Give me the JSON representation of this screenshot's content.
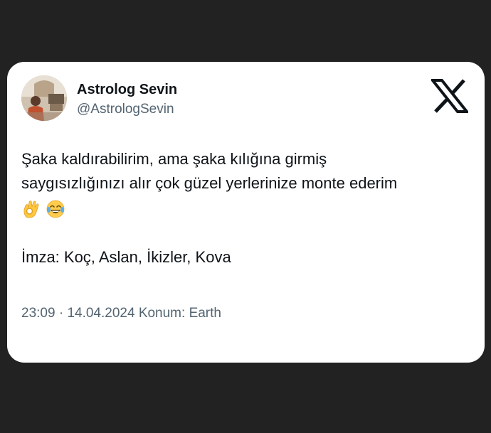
{
  "tweet": {
    "author": {
      "display_name": "Astrolog Sevin",
      "handle": "@AstrologSevin"
    },
    "platform_icon": "x-logo-icon",
    "text_line1": "Şaka kaldırabilirim, ama şaka kılığına girmiş",
    "text_line2": "saygısızlığınızı alır çok güzel yerlerinize monte ederim",
    "emojis": [
      "ok-hand-icon",
      "tears-of-joy-icon"
    ],
    "signature": "İmza: Koç, Aslan, İkizler, Kova",
    "meta": {
      "time": "23:09",
      "separator": "·",
      "date": "14.04.2024",
      "location": "Konum: Earth"
    }
  },
  "colors": {
    "page_background": "#222222",
    "card_background": "#ffffff",
    "text_primary": "#0f1419",
    "text_secondary": "#536471"
  }
}
